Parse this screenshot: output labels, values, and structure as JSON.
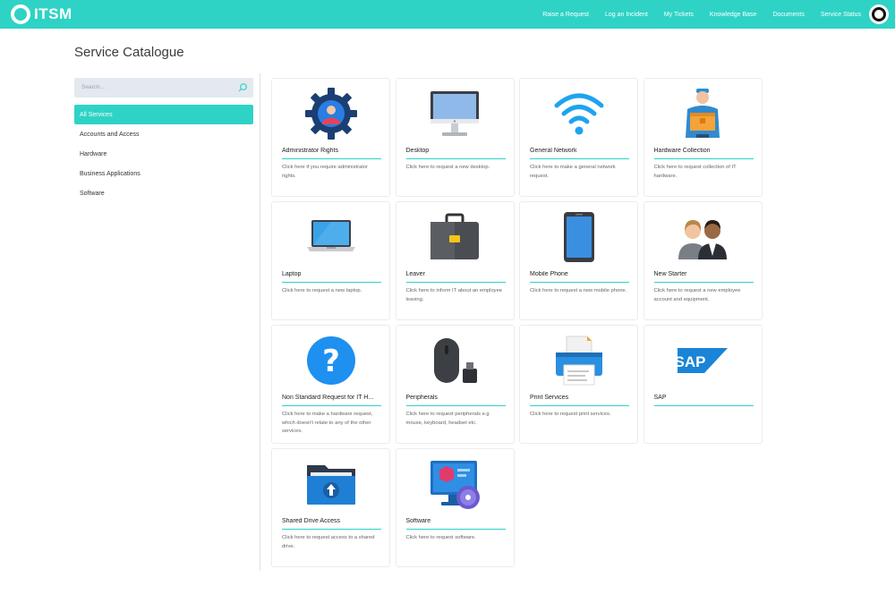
{
  "header": {
    "logo_text": "ITSM",
    "nav": [
      "Raise a Request",
      "Log an Incident",
      "My Tickets",
      "Knowledge Base",
      "Documents",
      "Service Status"
    ]
  },
  "page_title": "Service Catalogue",
  "search": {
    "placeholder": "Search..."
  },
  "sidebar": {
    "items": [
      {
        "label": "All Services",
        "active": true
      },
      {
        "label": "Accounts and Access"
      },
      {
        "label": "Hardware"
      },
      {
        "label": "Business Applications"
      },
      {
        "label": "Software"
      }
    ]
  },
  "colors": {
    "accent": "#2ed3c6"
  },
  "services": [
    {
      "name": "Administrator Rights",
      "desc": "Click here if you require administrator rights.",
      "icon": "gear-user-icon"
    },
    {
      "name": "Desktop",
      "desc": "Click here to request a new desktop.",
      "icon": "desktop-icon"
    },
    {
      "name": "General Network",
      "desc": "Click here to make a general network request.",
      "icon": "wifi-icon"
    },
    {
      "name": "Hardware Collection",
      "desc": "Click here to request collection of IT hardware.",
      "icon": "courier-icon"
    },
    {
      "name": "Laptop",
      "desc": "Click here to request a new laptop.",
      "icon": "laptop-icon"
    },
    {
      "name": "Leaver",
      "desc": "Click here to inform IT about an employee leaving.",
      "icon": "briefcase-icon"
    },
    {
      "name": "Mobile Phone",
      "desc": "Click here to request a new mobile phone.",
      "icon": "mobile-phone-icon"
    },
    {
      "name": "New Starter",
      "desc": "Click here to request a new employee account and equipment.",
      "icon": "people-icon"
    },
    {
      "name": "Non Standard Request for IT H...",
      "desc": "Click here to make a hardware request, which doesn't relate to any of the other services.",
      "icon": "question-icon"
    },
    {
      "name": "Peripherals",
      "desc": "Click here to request peripherals e.g mouse, keyboard, headset etc.",
      "icon": "mouse-icon"
    },
    {
      "name": "Print Services",
      "desc": "Click here to request print services.",
      "icon": "printer-icon"
    },
    {
      "name": "SAP",
      "desc": "",
      "icon": "sap-logo-icon",
      "logo_text": "SAP"
    },
    {
      "name": "Shared Drive Access",
      "desc": "Click here to request access to a shared drive.",
      "icon": "shared-folder-icon"
    },
    {
      "name": "Software",
      "desc": "Click here to request software.",
      "icon": "software-icon"
    }
  ]
}
